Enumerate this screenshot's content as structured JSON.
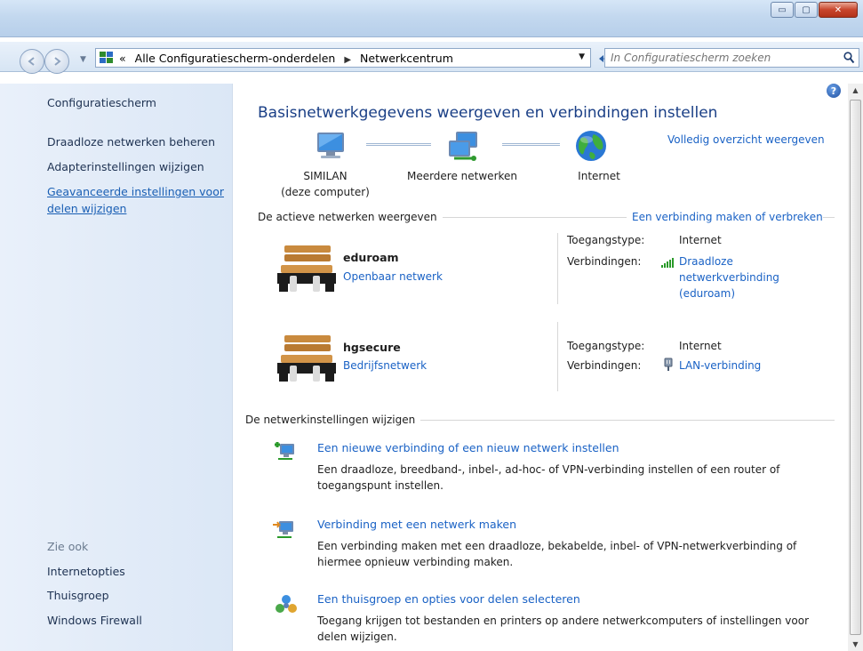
{
  "window": {
    "minimize_label": "▭",
    "maximize_label": "▢",
    "close_label": "✕"
  },
  "address": {
    "overflow": "«",
    "crumb1": "Alle Configuratiescherm-onderdelen",
    "crumb_sep": "▶",
    "crumb2": "Netwerkcentrum"
  },
  "search": {
    "placeholder": "In Configuratiescherm zoeken"
  },
  "sidebar": {
    "home": "Configuratiescherm",
    "links": [
      "Draadloze netwerken beheren",
      "Adapterinstellingen wijzigen",
      "Geavanceerde instellingen voor",
      "delen wijzigen"
    ],
    "see_also": "Zie ook",
    "see_also_links": [
      "Internetopties",
      "Thuisgroep",
      "Windows Firewall"
    ]
  },
  "main": {
    "title": "Basisnetwerkgegevens weergeven en verbindingen instellen",
    "full_map": "Volledig overzicht weergeven",
    "map": {
      "computer_name": "SIMILAN",
      "computer_sub": "(deze computer)",
      "multiple": "Meerdere netwerken",
      "internet": "Internet"
    },
    "active_section": "De actieve netwerken weergeven",
    "connect_disconnect": "Een verbinding maken of verbreken",
    "networks": [
      {
        "name": "eduroam",
        "category": "Openbaar netwerk",
        "access_label": "Toegangstype:",
        "access_value": "Internet",
        "conn_label": "Verbindingen:",
        "conn_value_lines": [
          "Draadloze",
          "netwerkverbinding",
          "(eduroam)"
        ]
      },
      {
        "name": "hgsecure",
        "category": "Bedrijfsnetwerk",
        "access_label": "Toegangstype:",
        "access_value": "Internet",
        "conn_label": "Verbindingen:",
        "conn_value_lines": [
          "LAN-verbinding"
        ]
      }
    ],
    "change_section": "De netwerkinstellingen wijzigen",
    "tasks": [
      {
        "title": "Een nieuwe verbinding of een nieuw netwerk instellen",
        "desc": "Een draadloze, breedband-, inbel-, ad-hoc- of VPN-verbinding instellen of een router of toegangspunt instellen."
      },
      {
        "title": "Verbinding met een netwerk maken",
        "desc": "Een verbinding maken met een draadloze, bekabelde, inbel- of VPN-netwerkverbinding of hiermee opnieuw verbinding maken."
      },
      {
        "title": "Een thuisgroep en opties voor delen selecteren",
        "desc": "Toegang krijgen tot bestanden en printers op andere netwerkcomputers of instellingen voor delen wijzigen."
      }
    ]
  },
  "help_label": "?",
  "colors": {
    "link": "#1a62c5",
    "title": "#1a3f86",
    "sidebar_bg": "#e3ecf8"
  }
}
